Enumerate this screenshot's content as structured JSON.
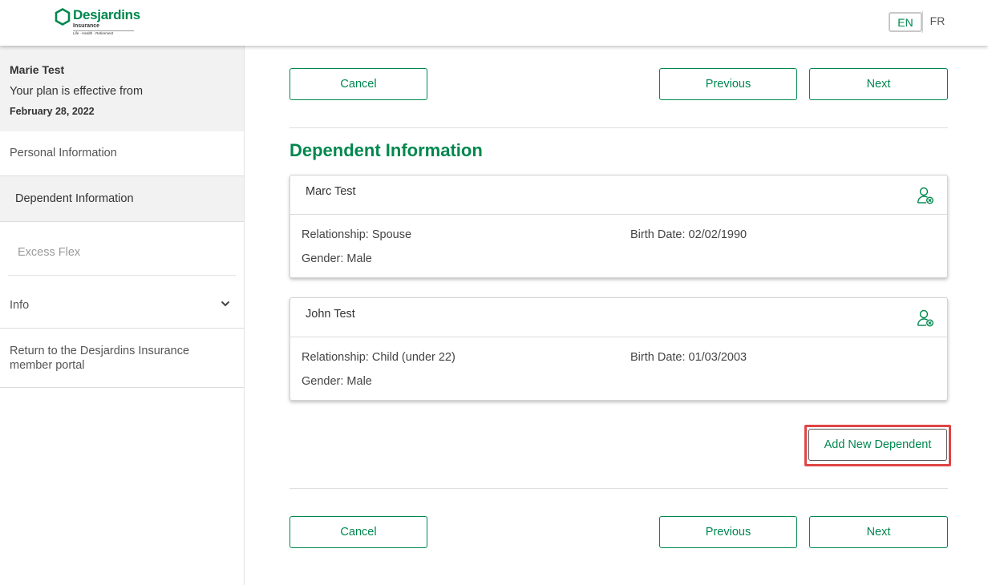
{
  "header": {
    "logo": {
      "name": "Desjardins",
      "sub": "Insurance",
      "tagline": "Life · Health · Retirement"
    },
    "languages": [
      {
        "label": "EN",
        "active": true
      },
      {
        "label": "FR",
        "active": false
      }
    ]
  },
  "sidebar": {
    "user": {
      "name": "Marie Test",
      "plan_text": "Your plan is effective from",
      "date": "February 28, 2022"
    },
    "items": [
      {
        "label": "Personal Information"
      },
      {
        "label": "Dependent Information"
      },
      {
        "label": "Excess Flex"
      },
      {
        "label": "Info"
      },
      {
        "label": "Return to the Desjardins Insurance member portal"
      }
    ]
  },
  "buttons": {
    "cancel": "Cancel",
    "previous": "Previous",
    "next": "Next",
    "add_dependent": "Add New Dependent"
  },
  "main": {
    "title": "Dependent Information",
    "dependents": [
      {
        "name": "Marc Test",
        "relationship": "Relationship: Spouse",
        "birth_date": "Birth Date: 02/02/1990",
        "gender": "Gender: Male"
      },
      {
        "name": "John Test",
        "relationship": "Relationship: Child (under 22)",
        "birth_date": "Birth Date: 01/03/2003",
        "gender": "Gender: Male"
      }
    ]
  },
  "colors": {
    "brand_green": "#00874e",
    "highlight_red": "#e04444"
  },
  "icons": {
    "logo": "hexagon-logo-icon",
    "info_toggle": "chevron-down-icon",
    "dependent_action": "remove-user-icon"
  }
}
